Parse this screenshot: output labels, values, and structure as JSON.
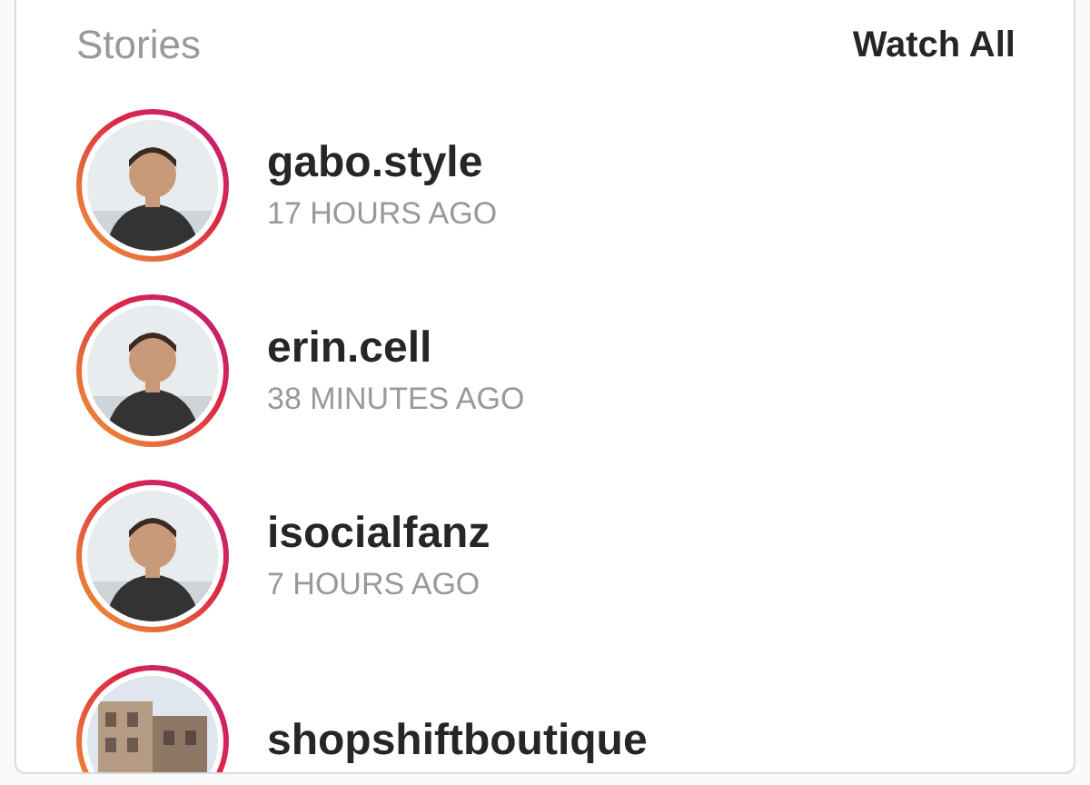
{
  "header": {
    "title": "Stories",
    "action": "Watch All"
  },
  "stories": [
    {
      "username": "gabo.style",
      "time": "17 HOURS AGO",
      "kind": "person"
    },
    {
      "username": "erin.cell",
      "time": "38 MINUTES AGO",
      "kind": "person"
    },
    {
      "username": "isocialfanz",
      "time": "7 HOURS AGO",
      "kind": "person"
    },
    {
      "username": "shopshiftboutique",
      "kind": "building"
    }
  ]
}
